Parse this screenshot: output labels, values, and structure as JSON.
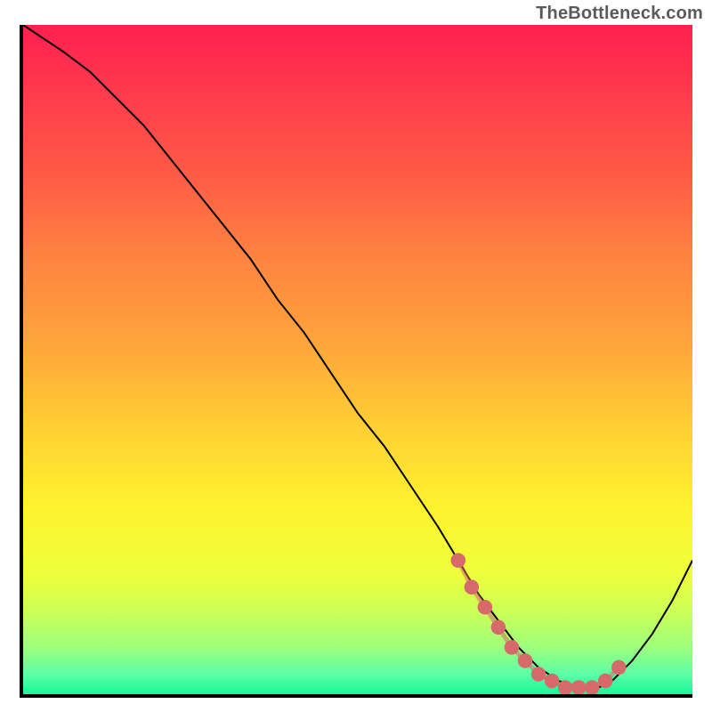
{
  "watermark": "TheBottleneck.com",
  "colors": {
    "gradient_stops": [
      {
        "offset": 0.0,
        "color": "#ff1f4f"
      },
      {
        "offset": 0.1,
        "color": "#ff3a4c"
      },
      {
        "offset": 0.22,
        "color": "#ff5a46"
      },
      {
        "offset": 0.35,
        "color": "#ff8440"
      },
      {
        "offset": 0.48,
        "color": "#ffa63a"
      },
      {
        "offset": 0.6,
        "color": "#ffcf33"
      },
      {
        "offset": 0.72,
        "color": "#fff22e"
      },
      {
        "offset": 0.82,
        "color": "#eeff3a"
      },
      {
        "offset": 0.88,
        "color": "#c9ff59"
      },
      {
        "offset": 0.93,
        "color": "#9dff7c"
      },
      {
        "offset": 0.97,
        "color": "#5cffa6"
      },
      {
        "offset": 1.0,
        "color": "#17f79a"
      }
    ],
    "curve": "#000000",
    "highlight": "#d66a6a",
    "axis": "#000000",
    "watermark": "#5a5a5a"
  },
  "chart_data": {
    "type": "line",
    "title": "",
    "xlabel": "",
    "ylabel": "",
    "xlim": [
      0,
      100
    ],
    "ylim": [
      0,
      100
    ],
    "grid": false,
    "series": [
      {
        "name": "curve",
        "x": [
          0,
          3,
          6,
          10,
          14,
          18,
          22,
          26,
          30,
          34,
          38,
          42,
          46,
          50,
          54,
          58,
          62,
          65,
          68,
          71,
          74,
          77,
          80,
          83,
          86,
          88,
          91,
          94,
          97,
          100
        ],
        "y": [
          100,
          98,
          96,
          93,
          89,
          85,
          80,
          75,
          70,
          65,
          59,
          54,
          48,
          42,
          37,
          31,
          25,
          20,
          15,
          11,
          7,
          4,
          2,
          1,
          1,
          2,
          5,
          9,
          14,
          20
        ]
      }
    ],
    "annotations": [
      {
        "name": "highlight-segment",
        "type": "dotted-overlay",
        "color": "#d66a6a",
        "x": [
          65,
          67,
          69,
          71,
          73,
          75,
          77,
          79,
          81,
          83,
          85,
          87,
          89
        ],
        "y": [
          20,
          16,
          13,
          10,
          7,
          5,
          3,
          2,
          1,
          1,
          1,
          2,
          4
        ]
      }
    ]
  }
}
